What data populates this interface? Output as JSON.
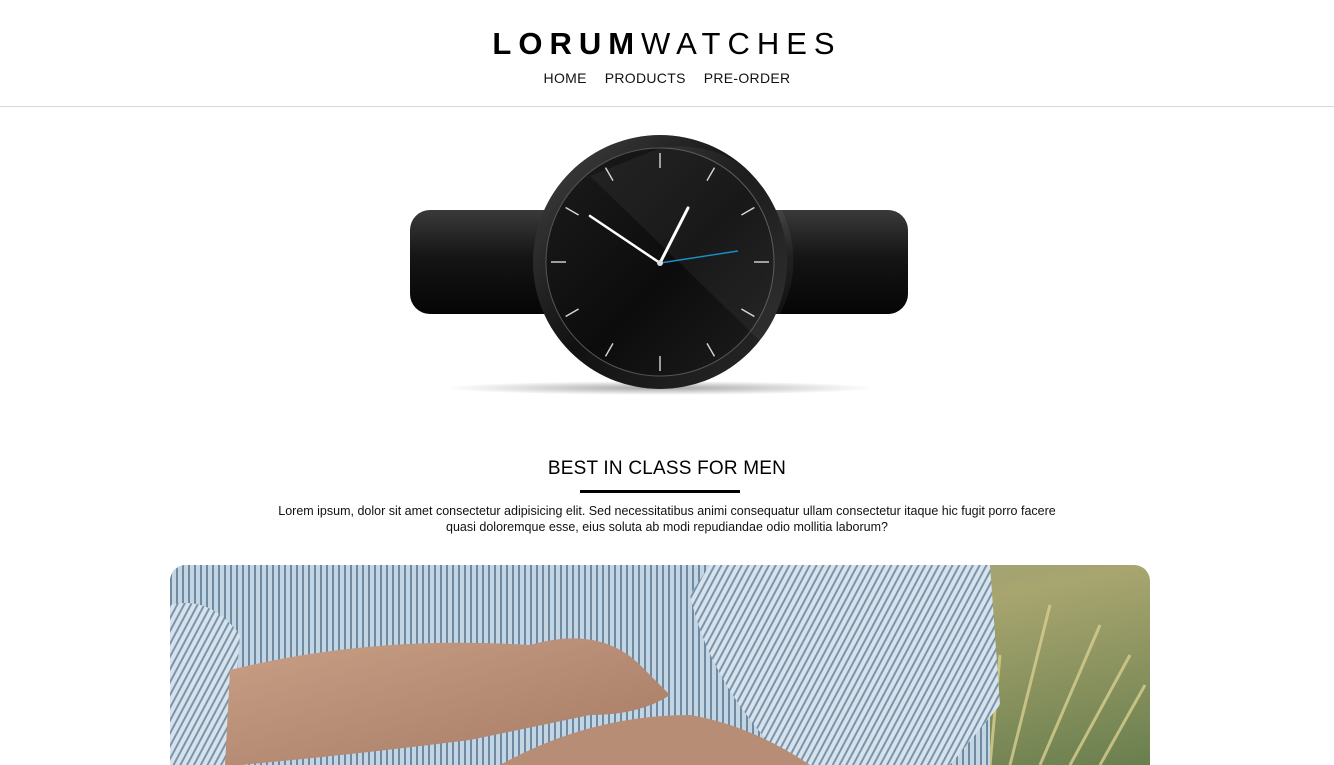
{
  "brand": {
    "bold": "LORUM",
    "light": "WATCHES"
  },
  "nav": [
    "HOME",
    "PRODUCTS",
    "PRE-ORDER"
  ],
  "section": {
    "title": "BEST IN CLASS FOR MEN",
    "description": "Lorem ipsum, dolor sit amet consectetur adipisicing elit. Sed necessitatibus animi consequatur ullam consectetur itaque hic fugit porro facere quasi doloremque esse, eius soluta ab modi repudiandae odio mollitia laborum?"
  },
  "colors": {
    "accent": "#1a8fc9",
    "text": "#111111",
    "divider": "#d9d9d9"
  }
}
